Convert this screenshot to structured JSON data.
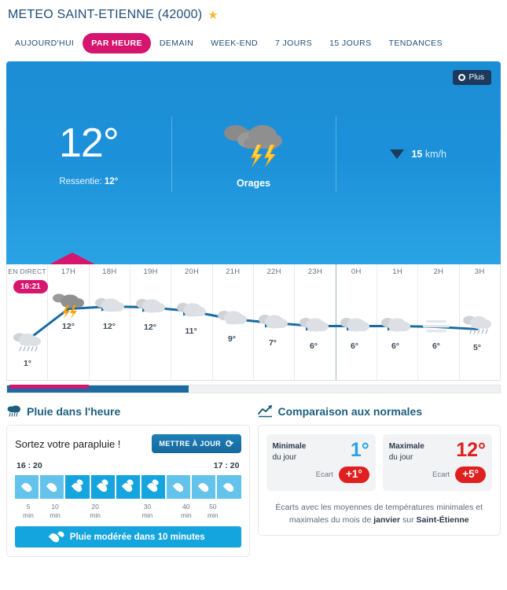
{
  "header": {
    "title": "METEO SAINT-ETIENNE (42000)",
    "favorite_icon": "star-icon",
    "tabs": [
      {
        "label": "AUJOURD'HUI",
        "active": false
      },
      {
        "label": "PAR HEURE",
        "active": true
      },
      {
        "label": "DEMAIN",
        "active": false
      },
      {
        "label": "WEEK-END",
        "active": false
      },
      {
        "label": "7 JOURS",
        "active": false
      },
      {
        "label": "15 JOURS",
        "active": false
      },
      {
        "label": "TENDANCES",
        "active": false
      }
    ]
  },
  "hero": {
    "plus_label": "Plus",
    "temperature": "12°",
    "feels_like_label": "Ressentie:",
    "feels_like_value": "12°",
    "condition": "Orages",
    "condition_icon": "thunderstorm-icon",
    "wind_speed": "15",
    "wind_unit": "km/h",
    "wind_direction_icon": "wind-arrow-south-icon"
  },
  "hourly": {
    "live_label": "EN DIRECT",
    "live_time": "16:21",
    "columns": [
      {
        "hour": "EN DIRECT",
        "temp": "1°",
        "icon": "rain-icon"
      },
      {
        "hour": "17H",
        "temp": "12°",
        "icon": "thunderstorm-icon"
      },
      {
        "hour": "18H",
        "temp": "12°",
        "icon": "cloudy-icon"
      },
      {
        "hour": "19H",
        "temp": "12°",
        "icon": "cloudy-icon"
      },
      {
        "hour": "20H",
        "temp": "11°",
        "icon": "cloudy-icon"
      },
      {
        "hour": "21H",
        "temp": "9°",
        "icon": "cloudy-icon"
      },
      {
        "hour": "22H",
        "temp": "7°",
        "icon": "cloudy-icon"
      },
      {
        "hour": "23H",
        "temp": "6°",
        "icon": "cloudy-icon"
      },
      {
        "hour": "0H",
        "temp": "6°",
        "icon": "cloudy-icon"
      },
      {
        "hour": "1H",
        "temp": "6°",
        "icon": "cloudy-icon"
      },
      {
        "hour": "2H",
        "temp": "6°",
        "icon": "mist-icon"
      },
      {
        "hour": "3H",
        "temp": "5°",
        "icon": "rain-icon"
      }
    ]
  },
  "rain": {
    "section_title": "Pluie dans l'heure",
    "section_icon": "rain-cloud-icon",
    "headline": "Sortez votre parapluie !",
    "update_button": "METTRE À JOUR",
    "update_icon": "refresh-icon",
    "start_time": "16 : 20",
    "end_time": "17 : 20",
    "cells": [
      {
        "intensity": "light"
      },
      {
        "intensity": "light"
      },
      {
        "intensity": "moderate"
      },
      {
        "intensity": "moderate"
      },
      {
        "intensity": "moderate"
      },
      {
        "intensity": "moderate"
      },
      {
        "intensity": "light"
      },
      {
        "intensity": "light"
      },
      {
        "intensity": "light"
      }
    ],
    "minute_ticks": [
      "5\nmin",
      "10\nmin",
      "20\nmin",
      "30\nmin",
      "40\nmin",
      "50\nmin"
    ],
    "banner_text": "Pluie modérée dans 10 minutes",
    "banner_icon": "rain-drops-icon"
  },
  "normals": {
    "section_title": "Comparaison aux normales",
    "section_icon": "chart-line-icon",
    "min": {
      "label_strong": "Minimale",
      "label_rest": "du jour",
      "value": "1°",
      "ecart_label": "Ecart",
      "ecart_value": "+1°"
    },
    "max": {
      "label_strong": "Maximale",
      "label_rest": "du jour",
      "value": "12°",
      "ecart_label": "Ecart",
      "ecart_value": "+5°"
    },
    "note_part1": "Écarts avec les moyennes de températures minimales et maximales du mois de ",
    "note_month": "janvier",
    "note_part2": " sur ",
    "note_city": "Saint-Étienne"
  },
  "colors": {
    "accent_magenta": "#d6156f",
    "brand_blue": "#1b8ed6",
    "navy": "#1b3a5c",
    "hot_red": "#e02020",
    "cold_blue": "#2aa3e4"
  }
}
